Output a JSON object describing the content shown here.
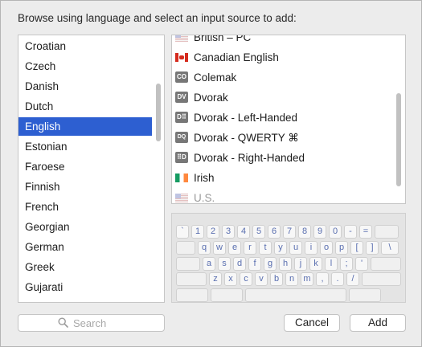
{
  "dialog": {
    "instruction": "Browse using language and select an input source to add:"
  },
  "languages": {
    "items": [
      {
        "label": "Croatian"
      },
      {
        "label": "Czech"
      },
      {
        "label": "Danish"
      },
      {
        "label": "Dutch"
      },
      {
        "label": "English",
        "selected": true
      },
      {
        "label": "Estonian"
      },
      {
        "label": "Faroese"
      },
      {
        "label": "Finnish"
      },
      {
        "label": "French"
      },
      {
        "label": "Georgian"
      },
      {
        "label": "German"
      },
      {
        "label": "Greek"
      },
      {
        "label": "Gujarati"
      }
    ]
  },
  "sources": {
    "items": [
      {
        "label": "British – PC",
        "icon": "british-flag-icon",
        "icon_text": "",
        "partial": true
      },
      {
        "label": "Canadian English",
        "icon": "canada-flag-icon",
        "icon_text": ""
      },
      {
        "label": "Colemak",
        "icon": "colemak-icon",
        "icon_text": "CO"
      },
      {
        "label": "Dvorak",
        "icon": "dvorak-icon",
        "icon_text": "DV"
      },
      {
        "label": "Dvorak - Left-Handed",
        "icon": "dvorak-left-icon",
        "icon_text": "D⠿"
      },
      {
        "label": "Dvorak - QWERTY ⌘",
        "icon": "dvorak-qwerty-icon",
        "icon_text": "DQ"
      },
      {
        "label": "Dvorak - Right-Handed",
        "icon": "dvorak-right-icon",
        "icon_text": "⠿D"
      },
      {
        "label": "Irish",
        "icon": "ireland-flag-icon",
        "icon_text": ""
      },
      {
        "label": "U.S.",
        "icon": "us-flag-icon",
        "icon_text": "",
        "dimmed": true
      }
    ]
  },
  "keyboard": {
    "rows": [
      [
        "`",
        "1",
        "2",
        "3",
        "4",
        "5",
        "6",
        "7",
        "8",
        "9",
        "0",
        "-",
        "=",
        ""
      ],
      [
        "",
        "q",
        "w",
        "e",
        "r",
        "t",
        "y",
        "u",
        "i",
        "o",
        "p",
        "[",
        "]",
        "\\"
      ],
      [
        "",
        "a",
        "s",
        "d",
        "f",
        "g",
        "h",
        "j",
        "k",
        "l",
        ";",
        "'",
        ""
      ],
      [
        "",
        "z",
        "x",
        "c",
        "v",
        "b",
        "n",
        "m",
        ",",
        ".",
        "/",
        ""
      ],
      [
        "",
        "",
        "",
        ""
      ]
    ]
  },
  "search": {
    "placeholder": "Search",
    "value": ""
  },
  "buttons": {
    "cancel": "Cancel",
    "add": "Add"
  },
  "colors": {
    "selection": "#2d5fd1",
    "key_text": "#5a6fb0"
  }
}
